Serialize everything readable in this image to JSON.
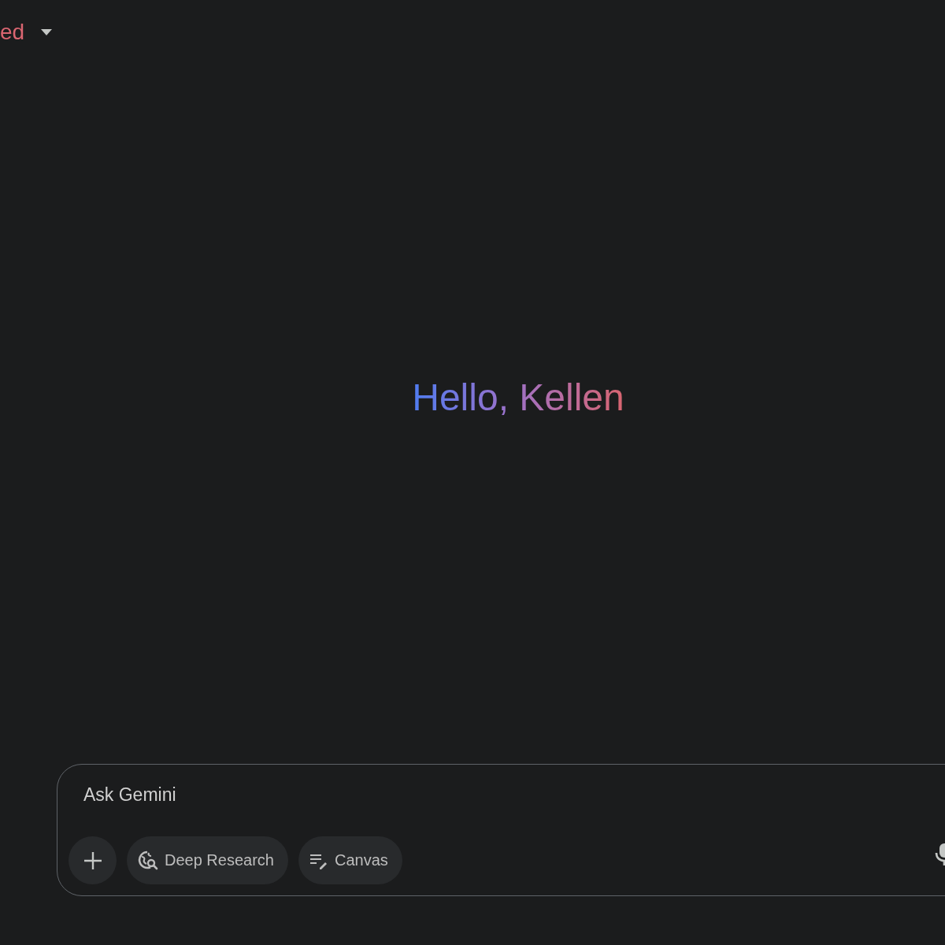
{
  "header": {
    "model_label": "ed"
  },
  "greeting": "Hello, Kellen",
  "composer": {
    "placeholder": "Ask Gemini",
    "tools": [
      {
        "kind": "add"
      },
      {
        "kind": "deep_research",
        "label": "Deep Research"
      },
      {
        "kind": "canvas",
        "label": "Canvas"
      }
    ]
  }
}
